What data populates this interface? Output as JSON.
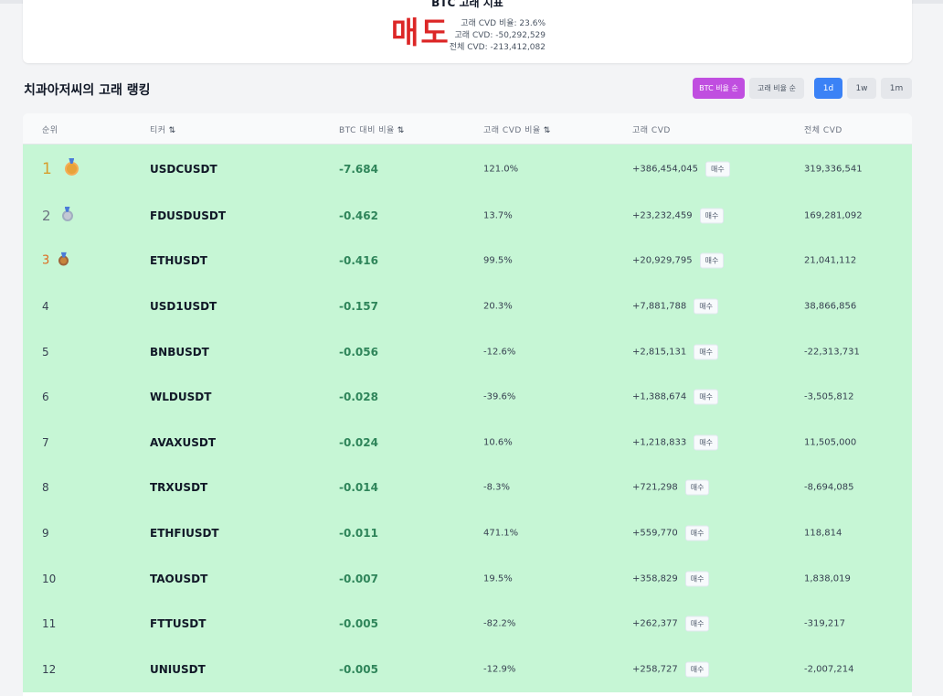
{
  "indicator": {
    "title": "BTC 고래 지표",
    "signal": "매도",
    "whale_cvd_ratio": "고래 CVD 비율: 23.6%",
    "whale_cvd": "고래 CVD: -50,292,529",
    "total_cvd": "전체 CVD: -213,412,082",
    "signal_color": "#dc2626"
  },
  "ranking": {
    "title": "치과아저씨의 고래 랭킹",
    "sort_buttons": [
      "BTC 비율 순",
      "고래 비율 순"
    ],
    "period_buttons": [
      "1d",
      "1w",
      "1m"
    ],
    "active_sort": "BTC 비율 순",
    "active_period": "1d"
  },
  "table": {
    "headers": {
      "rank": "순위",
      "ticker": "티커",
      "btc_ratio": "BTC 대비 비율",
      "whale_ratio": "고래 CVD 비율",
      "whale_cvd": "고래 CVD",
      "total_cvd": "전체 CVD"
    },
    "rows": [
      {
        "rank": "1",
        "medal": "gold-medal",
        "ticker": "USDCUSDT",
        "btc_ratio": "-7.684",
        "whale_ratio": "121.0%",
        "whale_cvd": "+386,454,045",
        "tag": "매수",
        "total_cvd": "319,336,541"
      },
      {
        "rank": "2",
        "medal": "silver-medal",
        "ticker": "FDUSDUSDT",
        "btc_ratio": "-0.462",
        "whale_ratio": "13.7%",
        "whale_cvd": "+23,232,459",
        "tag": "매수",
        "total_cvd": "169,281,092"
      },
      {
        "rank": "3",
        "medal": "bronze-medal",
        "ticker": "ETHUSDT",
        "btc_ratio": "-0.416",
        "whale_ratio": "99.5%",
        "whale_cvd": "+20,929,795",
        "tag": "매수",
        "total_cvd": "21,041,112"
      },
      {
        "rank": "4",
        "ticker": "USD1USDT",
        "btc_ratio": "-0.157",
        "whale_ratio": "20.3%",
        "whale_cvd": "+7,881,788",
        "tag": "매수",
        "total_cvd": "38,866,856"
      },
      {
        "rank": "5",
        "ticker": "BNBUSDT",
        "btc_ratio": "-0.056",
        "whale_ratio": "-12.6%",
        "whale_cvd": "+2,815,131",
        "tag": "매수",
        "total_cvd": "-22,313,731"
      },
      {
        "rank": "6",
        "ticker": "WLDUSDT",
        "btc_ratio": "-0.028",
        "whale_ratio": "-39.6%",
        "whale_cvd": "+1,388,674",
        "tag": "매수",
        "total_cvd": "-3,505,812"
      },
      {
        "rank": "7",
        "ticker": "AVAXUSDT",
        "btc_ratio": "-0.024",
        "whale_ratio": "10.6%",
        "whale_cvd": "+1,218,833",
        "tag": "매수",
        "total_cvd": "11,505,000"
      },
      {
        "rank": "8",
        "ticker": "TRXUSDT",
        "btc_ratio": "-0.014",
        "whale_ratio": "-8.3%",
        "whale_cvd": "+721,298",
        "tag": "매수",
        "total_cvd": "-8,694,085"
      },
      {
        "rank": "9",
        "ticker": "ETHFIUSDT",
        "btc_ratio": "-0.011",
        "whale_ratio": "471.1%",
        "whale_cvd": "+559,770",
        "tag": "매수",
        "total_cvd": "118,814"
      },
      {
        "rank": "10",
        "ticker": "TAOUSDT",
        "btc_ratio": "-0.007",
        "whale_ratio": "19.5%",
        "whale_cvd": "+358,829",
        "tag": "매수",
        "total_cvd": "1,838,019"
      },
      {
        "rank": "11",
        "ticker": "FTTUSDT",
        "btc_ratio": "-0.005",
        "whale_ratio": "-82.2%",
        "whale_cvd": "+262,377",
        "tag": "매수",
        "total_cvd": "-319,217"
      },
      {
        "rank": "12",
        "ticker": "UNIUSDT",
        "btc_ratio": "-0.005",
        "whale_ratio": "-12.9%",
        "whale_cvd": "+258,727",
        "tag": "매수",
        "total_cvd": "-2,007,214"
      }
    ]
  }
}
